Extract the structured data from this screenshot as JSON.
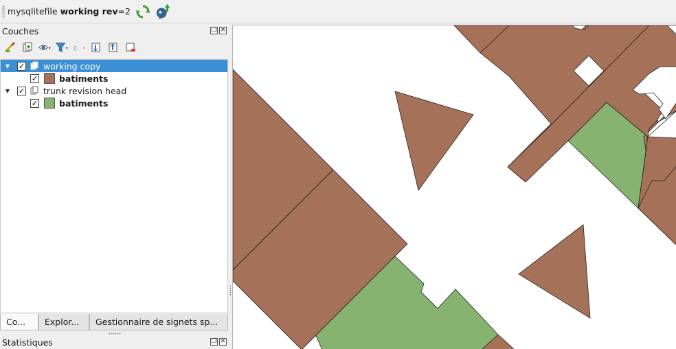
{
  "toolbar": {
    "project_prefix": "mysqlitefile ",
    "project_bold": "working rev",
    "project_suffix": "=2",
    "update_icon": "refresh-icon",
    "commit_icon": "postgres-commit-icon"
  },
  "layers_panel": {
    "title": "Couches",
    "float_icon": "float-panel-icon",
    "close_icon": "close-icon",
    "toolbar_icons": [
      "style-brush-icon",
      "add-group-icon",
      "visibility-eye-icon",
      "filter-icon",
      "expression-filter-icon",
      "expand-all-icon",
      "collapse-all-icon",
      "remove-layer-icon"
    ],
    "groups": [
      {
        "name": "working copy",
        "checked": true,
        "selected": true,
        "layers": [
          {
            "name": "batiments",
            "checked": true,
            "color": "#a57158"
          }
        ]
      },
      {
        "name": "trunk revision head",
        "checked": true,
        "selected": false,
        "layers": [
          {
            "name": "batiments",
            "checked": true,
            "color": "#86b36f"
          }
        ]
      }
    ],
    "tabs": [
      "Co...",
      "Explor...",
      "Gestionnaire de signets sp..."
    ]
  },
  "stats_panel": {
    "title": "Statistiques"
  },
  "colors": {
    "selection": "#3b8fd4",
    "building_working": "#a57158",
    "building_trunk": "#86b36f"
  }
}
